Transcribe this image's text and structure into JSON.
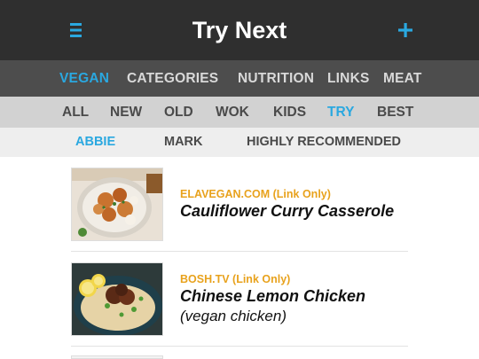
{
  "header": {
    "title": "Try Next",
    "menu_icon": "hamburger-menu-icon",
    "add_icon": "plus-icon",
    "accent_color": "#2aa8e0"
  },
  "nav_primary": {
    "items": [
      {
        "label": "VEGAN",
        "active": true
      },
      {
        "label": "CATEGORIES",
        "active": false
      },
      {
        "label": "NUTRITION",
        "active": false
      },
      {
        "label": "LINKS",
        "active": false
      },
      {
        "label": "MEAT",
        "active": false
      }
    ]
  },
  "nav_secondary": {
    "items": [
      {
        "label": "ALL",
        "active": false
      },
      {
        "label": "NEW",
        "active": false
      },
      {
        "label": "OLD",
        "active": false
      },
      {
        "label": "WOK",
        "active": false
      },
      {
        "label": "KIDS",
        "active": false
      },
      {
        "label": "TRY",
        "active": true
      },
      {
        "label": "BEST",
        "active": false
      }
    ]
  },
  "nav_tertiary": {
    "items": [
      {
        "label": "ABBIE",
        "active": true
      },
      {
        "label": "MARK",
        "active": false
      },
      {
        "label": "HIGHLY RECOMMENDED",
        "active": false
      }
    ]
  },
  "recipes": [
    {
      "source": "ELAVEGAN.COM (Link Only)",
      "name": "Cauliflower Curry Casserole",
      "subtitle": "",
      "source_color": "#e8a21d"
    },
    {
      "source": "BOSH.TV (Link Only)",
      "name": "Chinese Lemon Chicken",
      "subtitle": "(vegan chicken)",
      "source_color": "#e8a21d"
    }
  ]
}
